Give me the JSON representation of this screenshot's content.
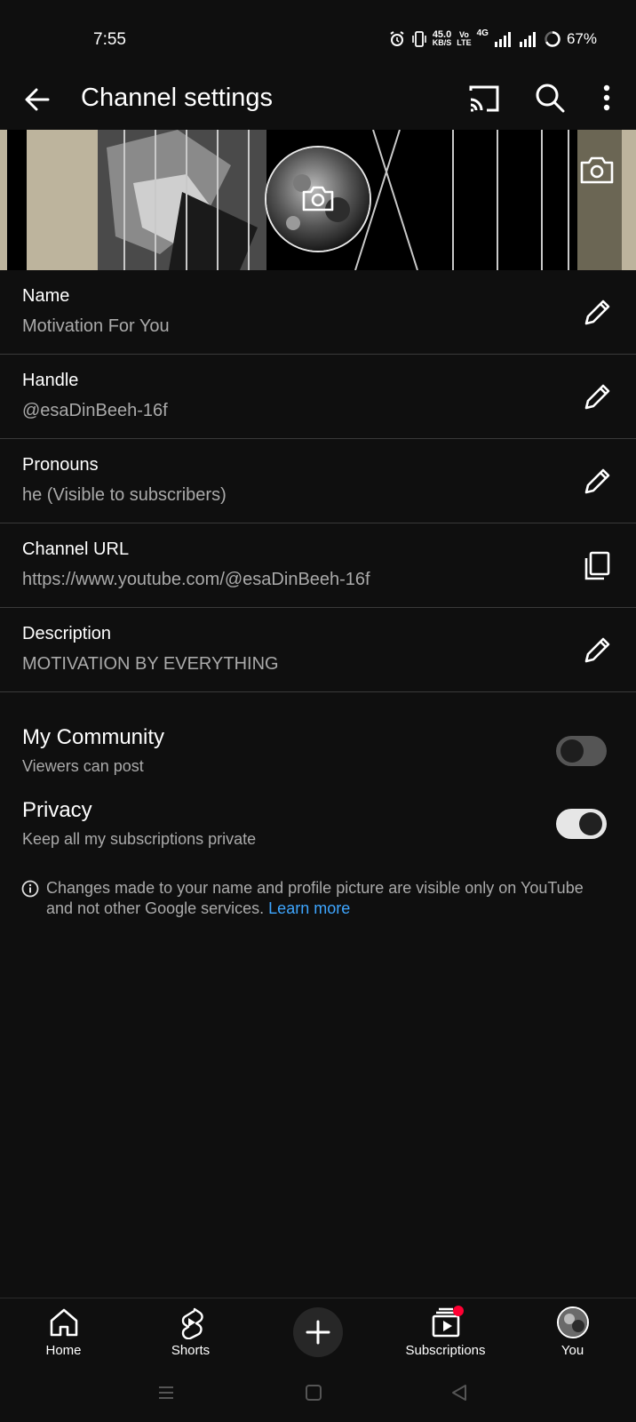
{
  "status_bar": {
    "time": "7:55",
    "net_speed_value": "45.0",
    "net_speed_unit": "KB/S",
    "volte_top": "Vo",
    "volte_bottom": "LTE",
    "net_type": "4G",
    "battery": "67%"
  },
  "app_bar": {
    "title": "Channel settings",
    "icons": [
      "back-arrow-icon",
      "cast-icon",
      "search-icon",
      "more-vert-icon"
    ]
  },
  "fields": [
    {
      "label": "Name",
      "value": "Motivation For You",
      "action_icon": "pencil-icon"
    },
    {
      "label": "Handle",
      "value": "@esaDinBeeh-16f",
      "action_icon": "pencil-icon"
    },
    {
      "label": "Pronouns",
      "value": "he (Visible to subscribers)",
      "action_icon": "pencil-icon"
    },
    {
      "label": "Channel URL",
      "value": "https://www.youtube.com/@esaDinBeeh-16f",
      "action_icon": "copy-icon"
    },
    {
      "label": "Description",
      "value": "MOTIVATION BY EVERYTHING",
      "action_icon": "pencil-icon"
    }
  ],
  "toggles": {
    "community": {
      "label": "My Community",
      "sub": "Viewers can post",
      "on": false
    },
    "privacy": {
      "label": "Privacy",
      "sub": "Keep all my subscriptions private",
      "on": true
    }
  },
  "info": {
    "text": "Changes made to your name and profile picture are visible only on YouTube and not other Google services.",
    "link": "Learn more"
  },
  "bottom_nav": {
    "home": "Home",
    "shorts": "Shorts",
    "subscriptions": "Subscriptions",
    "you": "You"
  },
  "colors": {
    "background": "#0f0f0f",
    "link": "#3ea6ff",
    "badge": "#ff0033",
    "secondary_text": "#aaaaaa"
  }
}
